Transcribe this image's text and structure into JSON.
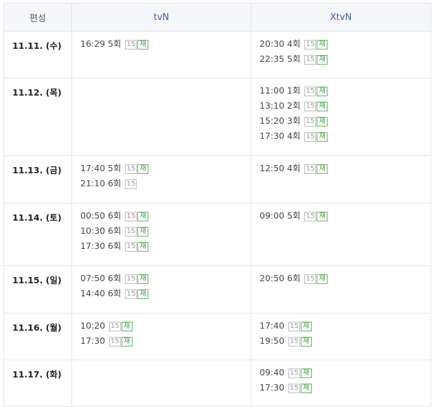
{
  "table": {
    "headers": {
      "date": "편성",
      "tvn": "tvN",
      "xtvn": "XtvN"
    },
    "badges": {
      "age": "15",
      "rerun": "재"
    },
    "rows": [
      {
        "date": "11.11. (수)",
        "tvn": [
          {
            "time": "16:29",
            "ep": "5회",
            "rerun": true
          }
        ],
        "xtvn": [
          {
            "time": "20:30",
            "ep": "4회",
            "rerun": true
          },
          {
            "time": "22:35",
            "ep": "5회",
            "rerun": true
          }
        ]
      },
      {
        "date": "11.12. (목)",
        "tvn": [],
        "xtvn": [
          {
            "time": "11:00",
            "ep": "1회",
            "rerun": true
          },
          {
            "time": "13:10",
            "ep": "2회",
            "rerun": true
          },
          {
            "time": "15:20",
            "ep": "3회",
            "rerun": true
          },
          {
            "time": "17:30",
            "ep": "4회",
            "rerun": true
          }
        ]
      },
      {
        "date": "11.13. (금)",
        "tvn": [
          {
            "time": "17:40",
            "ep": "5회",
            "rerun": true
          },
          {
            "time": "21:10",
            "ep": "6회",
            "rerun": false
          }
        ],
        "xtvn": [
          {
            "time": "12:50",
            "ep": "4회",
            "rerun": true
          }
        ]
      },
      {
        "date": "11.14. (토)",
        "tvn": [
          {
            "time": "00:50",
            "ep": "6회",
            "rerun": true
          },
          {
            "time": "10:30",
            "ep": "6회",
            "rerun": true
          },
          {
            "time": "17:30",
            "ep": "6회",
            "rerun": true
          }
        ],
        "xtvn": [
          {
            "time": "09:00",
            "ep": "5회",
            "rerun": true
          }
        ]
      },
      {
        "date": "11.15. (일)",
        "tvn": [
          {
            "time": "07:50",
            "ep": "6회",
            "rerun": true
          },
          {
            "time": "14:40",
            "ep": "6회",
            "rerun": true
          }
        ],
        "xtvn": [
          {
            "time": "20:50",
            "ep": "6회",
            "rerun": true
          }
        ]
      },
      {
        "date": "11.16. (월)",
        "tvn": [
          {
            "time": "10:20",
            "ep": "",
            "rerun": true
          },
          {
            "time": "17:30",
            "ep": "",
            "rerun": true
          }
        ],
        "xtvn": [
          {
            "time": "17:40",
            "ep": "",
            "rerun": true
          },
          {
            "time": "19:50",
            "ep": "",
            "rerun": true
          }
        ]
      },
      {
        "date": "11.17. (화)",
        "tvn": [],
        "xtvn": [
          {
            "time": "09:40",
            "ep": "",
            "rerun": true
          },
          {
            "time": "17:30",
            "ep": "",
            "rerun": true
          }
        ]
      }
    ]
  }
}
